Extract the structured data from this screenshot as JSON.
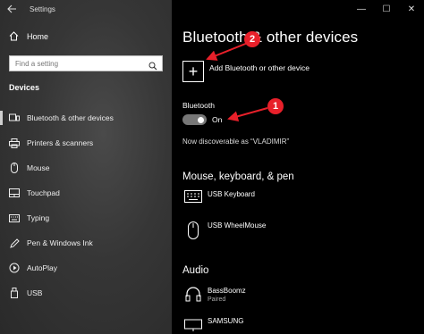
{
  "window": {
    "title": "Settings",
    "controls": [
      "—",
      "☐",
      "✕"
    ]
  },
  "sidebar": {
    "home_label": "Home",
    "search_placeholder": "Find a setting",
    "section_label": "Devices",
    "items": [
      {
        "label": "Bluetooth & other devices",
        "icon": "bluetooth-devices-icon",
        "active": true
      },
      {
        "label": "Printers & scanners",
        "icon": "printer-icon",
        "active": false
      },
      {
        "label": "Mouse",
        "icon": "mouse-icon",
        "active": false
      },
      {
        "label": "Touchpad",
        "icon": "touchpad-icon",
        "active": false
      },
      {
        "label": "Typing",
        "icon": "keyboard-icon",
        "active": false
      },
      {
        "label": "Pen & Windows Ink",
        "icon": "pen-icon",
        "active": false
      },
      {
        "label": "AutoPlay",
        "icon": "autoplay-icon",
        "active": false
      },
      {
        "label": "USB",
        "icon": "usb-icon",
        "active": false
      }
    ]
  },
  "main": {
    "page_title": "Bluetooth & other devices",
    "add_device_label": "Add Bluetooth or other device",
    "bluetooth_label": "Bluetooth",
    "bluetooth_state": "On",
    "discoverable_text": "Now discoverable as “VLADIMIR”",
    "groups": [
      {
        "title": "Mouse, keyboard, & pen",
        "devices": [
          {
            "name": "USB Keyboard",
            "status": "",
            "icon": "keyboard-icon"
          },
          {
            "name": "USB WheelMouse",
            "status": "",
            "icon": "mouse-icon"
          }
        ]
      },
      {
        "title": "Audio",
        "devices": [
          {
            "name": "BassBoomz",
            "status": "Paired",
            "icon": "headphones-icon"
          },
          {
            "name": "SAMSUNG",
            "status": "",
            "icon": "monitor-icon"
          }
        ]
      }
    ]
  },
  "annotations": {
    "badge_1": "1",
    "badge_2": "2",
    "color": "#e8202a"
  }
}
